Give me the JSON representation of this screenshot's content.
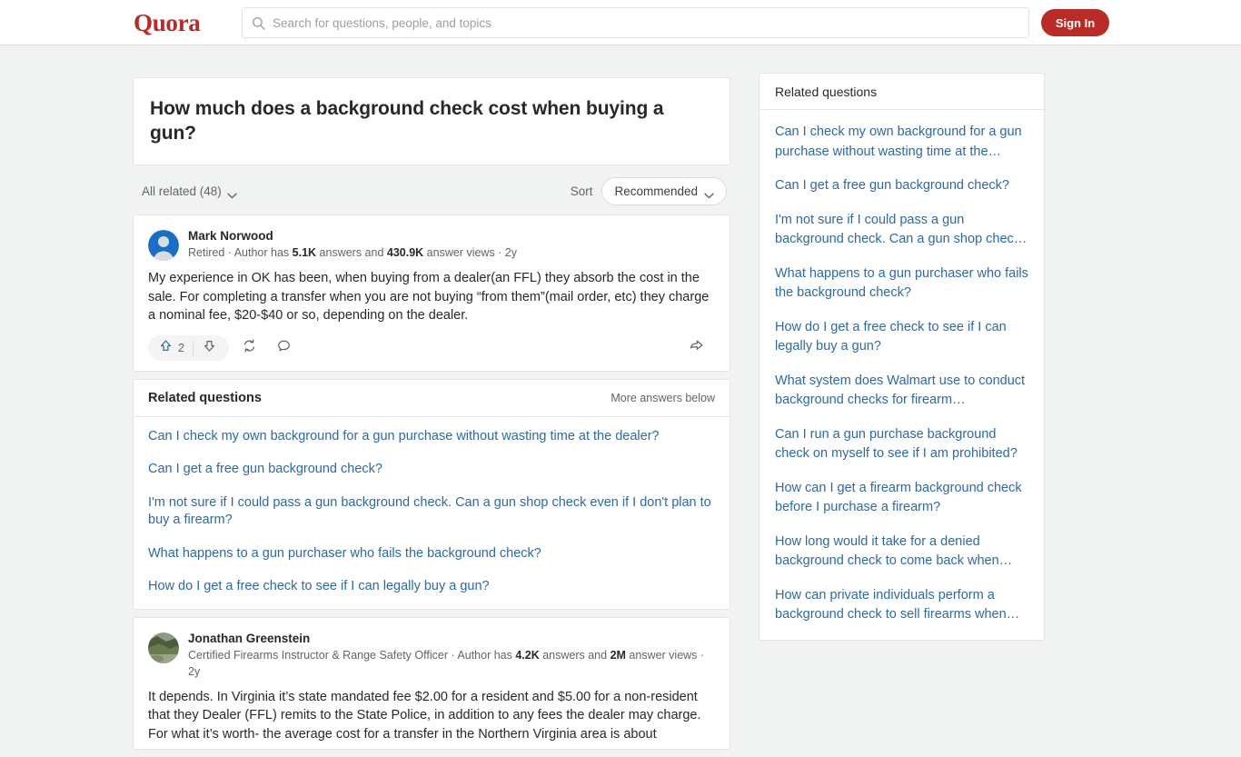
{
  "header": {
    "logo": "Quora",
    "search_placeholder": "Search for questions, people, and topics",
    "search_value": "",
    "signin_label": "Sign In"
  },
  "question": {
    "title": "How much does a background check cost when buying a gun?"
  },
  "filters": {
    "all_related_label": "All related (48)",
    "sort_label": "Sort",
    "sort_value": "Recommended"
  },
  "answers": [
    {
      "author_name": "Mark Norwood",
      "credential_prefix": "Retired · Author has ",
      "answers_count": "5.1K",
      "credential_mid": " answers and ",
      "views_count": "430.9K",
      "credential_suffix": " answer views · 2y",
      "body": "My experience in OK has been, when buying from a dealer(an FFL) they absorb the cost in the sale. For completing a transfer when you are not buying “from them”(mail order, etc) they charge a nominal fee, $20-$40 or so, depending on the dealer.",
      "upvote_count": "2"
    },
    {
      "author_name": "Jonathan Greenstein",
      "credential_prefix": "Certified Firearms Instructor & Range Safety Officer · Author has ",
      "answers_count": "4.2K",
      "credential_mid": " answers and ",
      "views_count": "2M",
      "credential_suffix": " answer views · 2y",
      "body": "It depends. In Virginia it’s state mandated fee $2.00 for a resident and $5.00 for a non-resident that they Dealer (FFL) remits to the State Police, in addition to any fees the dealer may charge. For what it’s worth- the average cost for a transfer in the Northern Virginia area is about"
    }
  ],
  "related_questions_main": {
    "title": "Related questions",
    "more_label": "More answers below",
    "items": [
      "Can I check my own background for a gun purchase without wasting time at the dealer?",
      "Can I get a free gun background check?",
      "I'm not sure if I could pass a gun background check. Can a gun shop check even if I don't plan to buy a firearm?",
      "What happens to a gun purchaser who fails the background check?",
      "How do I get a free check to see if I can legally buy a gun?"
    ]
  },
  "sidebar": {
    "title": "Related questions",
    "items": [
      "Can I check my own background for a gun purchase without wasting time at the…",
      "Can I get a free gun background check?",
      "I'm not sure if I could pass a gun background check. Can a gun shop chec…",
      "What happens to a gun purchaser who fails the background check?",
      "How do I get a free check to see if I can legally buy a gun?",
      "What system does Walmart use to conduct background checks for firearm…",
      "Can I run a gun purchase background check on myself to see if I am prohibited?",
      "How can I get a firearm background check before I purchase a firearm?",
      "How long would it take for a denied background check to come back when…",
      "How can private individuals perform a background check to sell firearms when…"
    ]
  },
  "colors": {
    "brand_red": "#b92b27",
    "link_blue": "#2e69a3",
    "upvote_blue": "#2e69a3",
    "page_bg": "#f1f2f2",
    "text": "#282829",
    "muted": "#636466"
  }
}
